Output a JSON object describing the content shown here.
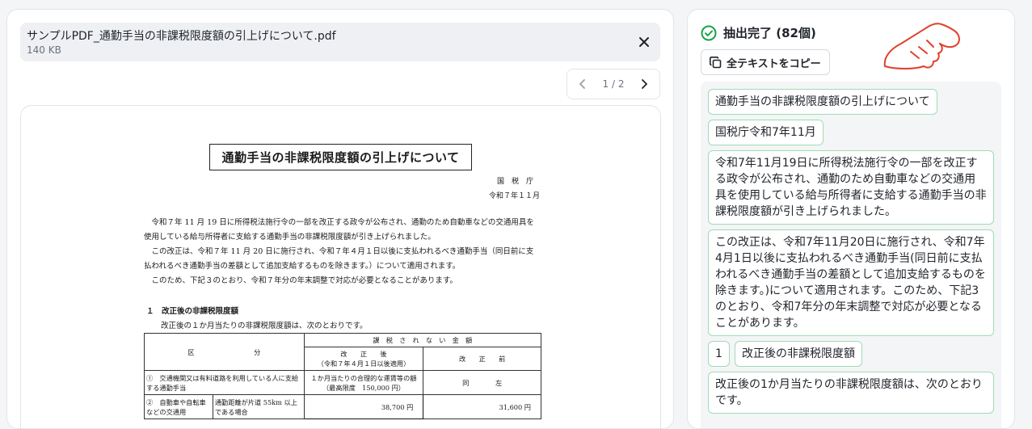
{
  "file": {
    "name": "サンプルPDF_通勤手当の非課税限度額の引上げについて.pdf",
    "size": "140 KB"
  },
  "pager": {
    "text": "1 / 2"
  },
  "document": {
    "title": "通勤手当の非課税限度額の引上げについて",
    "issuer": "国税庁",
    "date": "令和７年１１月",
    "para1": "　令和７年 11 月 19 日に所得税法施行令の一部を改正する政令が公布され、通勤のため自動車などの交通用具を使用している給与所得者に支給する通勤手当の非課税限度額が引き上げられました。",
    "para2": "　この改正は、令和７年 11 月 20 日に施行され、令和７年４月１日以後に支払われるべき通勤手当（同日前に支払われるべき通勤手当の差額として追加支給するものを除きます。）について適用されます。",
    "para3": "　このため、下記３のとおり、令和７年分の年末調整で対応が必要となることがあります。",
    "section1_heading": "１　改正後の非課税限度額",
    "section1_body": "改正後の１か月当たりの非課税限度額は、次のとおりです。",
    "table": {
      "h_kubun": "区　　　　　　　　　分",
      "h_amount": "課　税　さ　れ　な　い　金　額",
      "h_after": "改　　正　　後",
      "h_after_note": "（令和７年４月１日以後適用）",
      "h_before": "改　　正　　前",
      "r1_label": "①　交通機関又は有料道路を利用している人に支給する通勤手当",
      "r1_after": "１か月当たりの合理的な運賃等の額",
      "r1_after_note": "（最高限度　150,000 円）",
      "r1_before": "同　　　　左",
      "r2_label": "②　自動車や自転車などの交通用",
      "r2_sub": "通勤距離が片道 55km 以上である場合",
      "r2_after": "38,700 円",
      "r2_before": "31,600 円"
    }
  },
  "panel": {
    "status": "抽出完了 (82個)",
    "copy_all_label": "全テキストをコピー",
    "chips": [
      "通勤手当の非課税限度額の引上げについて",
      "国税庁令和7年11月",
      "令和7年11月19日に所得税法施行令の一部を改正する政令が公布され、通勤のため自動車などの交通用具を使用している給与所得者に支給する通勤手当の非課税限度額が引き上げられました。",
      "この改正は、令和7年11月20日に施行され、令和7年4月1日以後に支払われるべき通勤手当(同日前に支払われるべき通勤手当の差額として追加支給するものを除きます。)について適用されます。このため、下記3のとおり、令和7年分の年末調整で対応が必要となることがあります。",
      "1",
      "改正後の非課税限度額",
      "改正後の1か月当たりの非課税限度額は、次のとおりです。"
    ]
  },
  "colors": {
    "accent_green": "#16a34a",
    "chip_border": "#9fdcb4",
    "hand_red": "#e0402e"
  }
}
